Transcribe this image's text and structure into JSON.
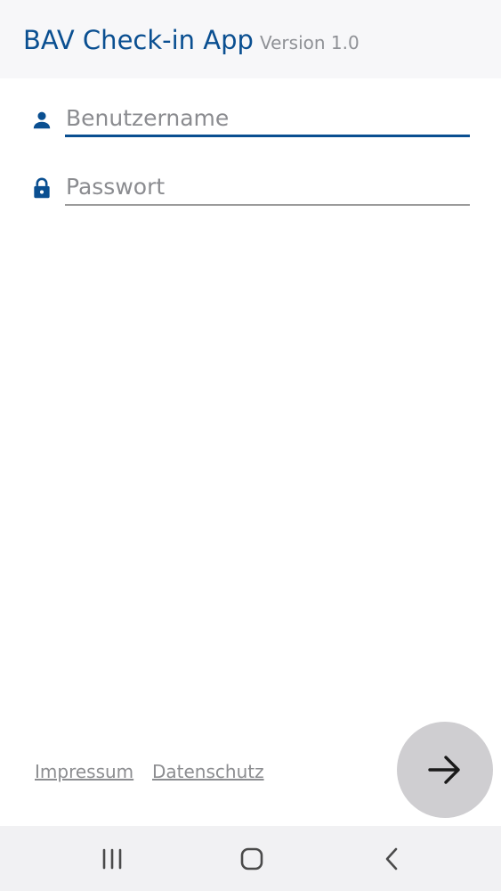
{
  "header": {
    "title": "BAV Check-in App",
    "version": "Version 1.0"
  },
  "login_form": {
    "username": {
      "placeholder": "Benutzername",
      "value": "",
      "icon": "person-icon"
    },
    "password": {
      "placeholder": "Passwort",
      "value": "",
      "icon": "lock-icon"
    },
    "submit": {
      "icon": "arrow-right-icon"
    }
  },
  "footer": {
    "impressum_label": "Impressum",
    "datenschutz_label": "Datenschutz"
  },
  "system_nav": {
    "buttons": [
      "recent-apps-icon",
      "home-icon",
      "back-icon"
    ]
  },
  "colors": {
    "accent": "#0a4f91",
    "header_background": "#f7f7f9",
    "text_muted": "#8c8d90",
    "submit_background": "#cfced1",
    "navbar_background": "#f1f1f3"
  }
}
